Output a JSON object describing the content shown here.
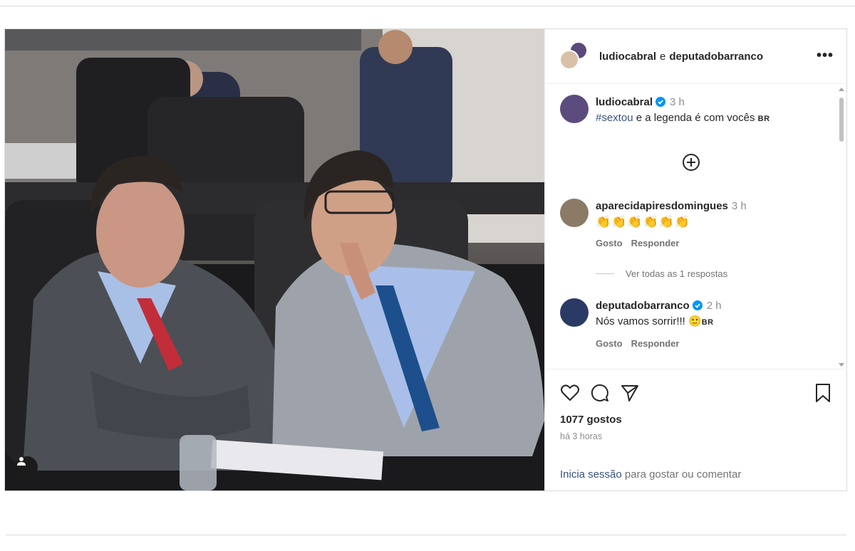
{
  "post": {
    "header": {
      "user1": "ludiocabral",
      "joiner": "e",
      "user2": "deputadobarranco",
      "more_icon": "more-horizontal-icon",
      "more_label": "•••"
    },
    "caption": {
      "username": "ludiocabral",
      "time": "3 h",
      "hashtag": "#sextou",
      "text": " e a legenda é com vocês ",
      "flag": "BR"
    },
    "load_more_icon": "plus-circle-icon",
    "comments": [
      {
        "username": "aparecidapiresdomingues",
        "time": "3 h",
        "text": "👏👏👏👏👏👏",
        "like_label": "Gosto",
        "reply_label": "Responder"
      },
      {
        "username": "deputadobarranco",
        "time": "2 h",
        "text": "Nós vamos sorrir!!! ",
        "emoji": "🙂",
        "flag": "BR",
        "like_label": "Gosto",
        "reply_label": "Responder"
      }
    ],
    "view_replies": "Ver todas as 1 respostas",
    "likes": "1077 gostos",
    "time_ago": "há 3 horas",
    "login_link": "Inicia sessão",
    "login_text": " para gostar ou comentar",
    "colors": {
      "link": "#385185",
      "verified": "#0095f6",
      "muted": "#8e8e8e"
    },
    "icons": [
      "heart-icon",
      "comment-icon",
      "share-icon",
      "bookmark-icon",
      "user-tag-icon"
    ]
  }
}
